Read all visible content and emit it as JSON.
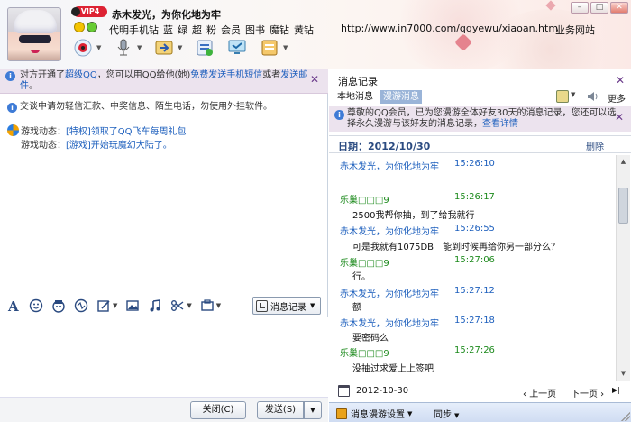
{
  "header": {
    "vip_badge": "VIP4",
    "contact_name": "赤木发光，为你化地为牢",
    "service_links": [
      "代明手机钻",
      "蓝",
      "绿",
      "超",
      "粉",
      "会员",
      "图书",
      "魔钻",
      "黄钻"
    ],
    "url": "http://www.in7000.com/qqyewu/xiaoan.htm",
    "site_link": "业务网站",
    "window_controls": [
      "minimize",
      "maximize",
      "close"
    ],
    "toolbar_icons": [
      "video-call",
      "voice-call",
      "transfer-file",
      "create-group",
      "remote-assist",
      "app-menu"
    ]
  },
  "left": {
    "notice": {
      "prefix": "对方开通了",
      "link1": "超级QQ",
      "middle": "，您可以用QQ给他(她)",
      "link2": "免费发送手机短信",
      "suffix": "或者",
      "link3": "发送邮件",
      "end": "。"
    },
    "warning": "交谈中请勿轻信汇款、中奖信息、陌生电话，勿使用外挂软件。",
    "games": [
      {
        "prefix": "游戏动态：",
        "link": "[特权]领取了QQ飞车每周礼包"
      },
      {
        "prefix": "游戏动态：",
        "link": "[游戏]开始玩魔幻大陆了。"
      }
    ],
    "format_tools": [
      "font",
      "emoticon",
      "magic-expression",
      "shake",
      "graffiti",
      "image",
      "music",
      "screenshot",
      "more"
    ],
    "history_button": "消息记录",
    "close_button": "关闭(C)",
    "send_button": "发送(S)"
  },
  "right": {
    "title": "消息记录",
    "tabs": [
      "本地消息",
      "漫游消息"
    ],
    "more": "更多",
    "vip_notice": {
      "text": "尊敬的QQ会员，已为您漫游全体好友30天的消息记录，您还可以选择永久漫游与该好友的消息记录，",
      "link": "查看详情"
    },
    "date_label": "日期：2012/10/30",
    "delete": "删除",
    "messages": [
      {
        "sender": "赤木发光，为你化地为牢",
        "time": "15:26:10",
        "color": "blue",
        "text": ""
      },
      {
        "sender": "乐巢□□□9",
        "time": "15:26:17",
        "color": "green",
        "text": "2500我帮你抽，到了给我就行"
      },
      {
        "sender": "赤木发光，为你化地为牢",
        "time": "15:26:55",
        "color": "blue",
        "text": "可是我就有1075DB　能到时候再给你另一部分么？"
      },
      {
        "sender": "乐巢□□□9",
        "time": "15:27:06",
        "color": "green",
        "text": "行。"
      },
      {
        "sender": "赤木发光，为你化地为牢",
        "time": "15:27:12",
        "color": "blue",
        "text": "额"
      },
      {
        "sender": "赤木发光，为你化地为牢",
        "time": "15:27:18",
        "color": "blue",
        "text": "要密码么"
      },
      {
        "sender": "乐巢□□□9",
        "time": "15:27:26",
        "color": "green",
        "text": "没抽过求爱上上签吧"
      }
    ],
    "nav_date": "2012-10-30",
    "prev": "上一页",
    "next": "下一页",
    "roam_settings": "消息漫游设置",
    "sync": "同步"
  },
  "colors": {
    "link_blue": "#1d5fbd",
    "self_name_blue": "#1d5fbd",
    "peer_name_green": "#1c8a1c",
    "notice_bg": "#ece3ee",
    "tab_active_bg": "#9ab4d8"
  }
}
